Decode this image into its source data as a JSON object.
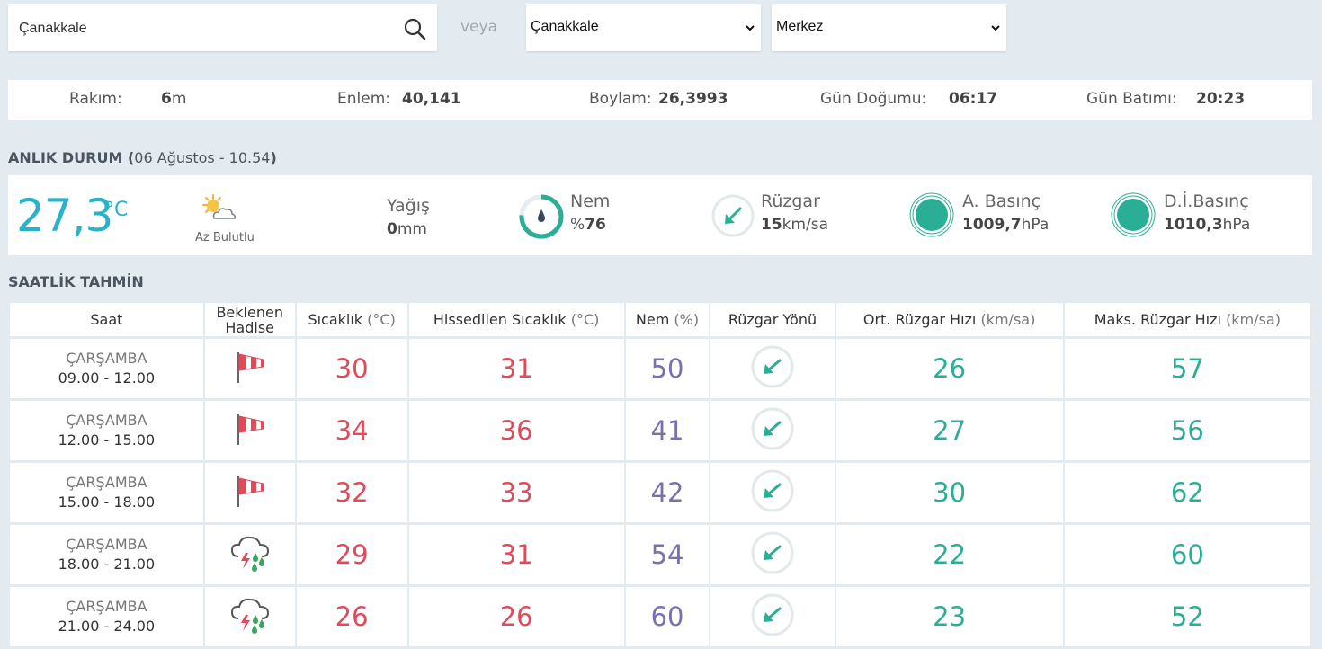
{
  "search": {
    "value": "Çanakkale",
    "placeholder": ""
  },
  "or_label": "veya",
  "province_select": {
    "selected": "Çanakkale"
  },
  "district_select": {
    "selected": "Merkez"
  },
  "info": {
    "altitude_label": "Rakım:",
    "altitude_value": "6",
    "altitude_unit": "m",
    "lat_label": "Enlem:",
    "lat_value": "40,141",
    "lon_label": "Boylam:",
    "lon_value": "26,3993",
    "sunrise_label": "Gün Doğumu:",
    "sunrise_value": "06:17",
    "sunset_label": "Gün Batımı:",
    "sunset_value": "20:23"
  },
  "current": {
    "title": "ANLIK DURUM",
    "paren_open": "(",
    "datetime": "06 Ağustos - 10.54",
    "paren_close": ")",
    "temperature": "27,3",
    "temp_unit": "°C",
    "sky": "Az Bulutlu",
    "sky_icon": "sun-cloud-icon",
    "rain_label": "Yağış",
    "rain_value": "0",
    "rain_unit": "mm",
    "humidity_label": "Nem",
    "humidity_prefix": "%",
    "humidity_value": "76",
    "humidity_fraction": 0.76,
    "wind_label": "Rüzgar",
    "wind_value": "15",
    "wind_unit": "km/sa",
    "pressure_label": "A. Basınç",
    "pressure_value": "1009,7",
    "pressure_unit": "hPa",
    "sea_pressure_label": "D.İ.Basınç",
    "sea_pressure_value": "1010,3",
    "sea_pressure_unit": "hPa"
  },
  "hourly": {
    "title": "SAATLİK TAHMİN",
    "headers": {
      "saat": "Saat",
      "hadise_1": "Beklenen",
      "hadise_2": "Hadise",
      "temp": "Sıcaklık",
      "temp_unit": "(°C)",
      "feels": "Hissedilen Sıcaklık",
      "feels_unit": "(°C)",
      "humidity": "Nem",
      "humidity_unit": "(%)",
      "wind_dir": "Rüzgar Yönü",
      "avg_wind": "Ort. Rüzgar Hızı",
      "avg_wind_unit": "(km/sa)",
      "max_wind": "Maks. Rüzgar Hızı",
      "max_wind_unit": "(km/sa)"
    },
    "rows": [
      {
        "day": "ÇARŞAMBA",
        "time": "09.00 - 12.00",
        "icon": "windsock-icon",
        "temp": "30",
        "feels": "31",
        "humidity": "50",
        "avg_wind": "26",
        "max_wind": "57"
      },
      {
        "day": "ÇARŞAMBA",
        "time": "12.00 - 15.00",
        "icon": "windsock-icon",
        "temp": "34",
        "feels": "36",
        "humidity": "41",
        "avg_wind": "27",
        "max_wind": "56"
      },
      {
        "day": "ÇARŞAMBA",
        "time": "15.00 - 18.00",
        "icon": "windsock-icon",
        "temp": "32",
        "feels": "33",
        "humidity": "42",
        "avg_wind": "30",
        "max_wind": "62"
      },
      {
        "day": "ÇARŞAMBA",
        "time": "18.00 - 21.00",
        "icon": "thunderstorm-rain-icon",
        "temp": "29",
        "feels": "31",
        "humidity": "54",
        "avg_wind": "22",
        "max_wind": "60"
      },
      {
        "day": "ÇARŞAMBA",
        "time": "21.00 - 24.00",
        "icon": "thunderstorm-rain-icon",
        "temp": "26",
        "feels": "26",
        "humidity": "60",
        "avg_wind": "23",
        "max_wind": "52"
      }
    ]
  },
  "colors": {
    "temp": "#e04b5a",
    "humidity": "#7b6fad",
    "wind": "#2bae96",
    "accent": "#29b2c9"
  }
}
